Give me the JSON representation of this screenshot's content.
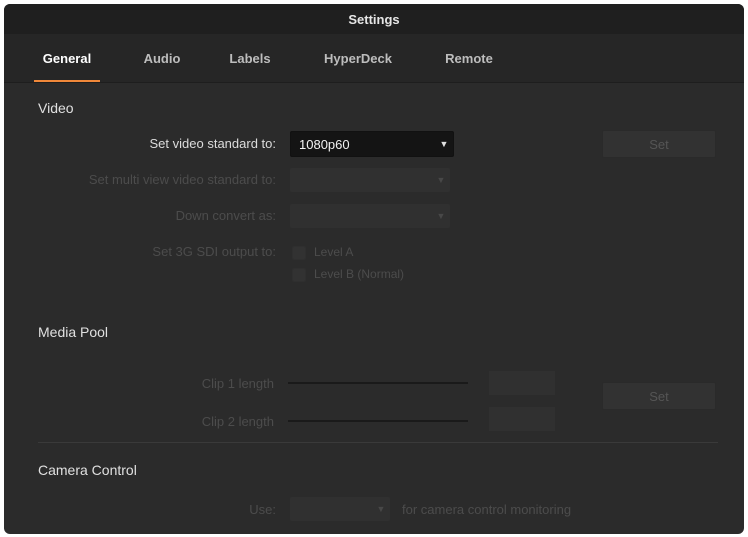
{
  "window": {
    "title": "Settings"
  },
  "tabs": [
    {
      "label": "General",
      "active": true
    },
    {
      "label": "Audio",
      "active": false
    },
    {
      "label": "Labels",
      "active": false
    },
    {
      "label": "HyperDeck",
      "active": false
    },
    {
      "label": "Remote",
      "active": false
    }
  ],
  "video": {
    "title": "Video",
    "standard_label": "Set video standard to:",
    "standard_value": "1080p60",
    "set_label": "Set",
    "multiview_label": "Set multi view video standard to:",
    "multiview_value": "",
    "downconvert_label": "Down convert as:",
    "downconvert_value": "",
    "sdi_label": "Set 3G SDI output to:",
    "level_a": "Level A",
    "level_b": "Level B (Normal)"
  },
  "media_pool": {
    "title": "Media Pool",
    "clip1_label": "Clip 1 length",
    "clip2_label": "Clip 2 length",
    "set_label": "Set"
  },
  "camera_control": {
    "title": "Camera Control",
    "use_label": "Use:",
    "use_value": "",
    "suffix": "for camera control monitoring"
  },
  "colors": {
    "accent": "#f0883a",
    "window_bg": "#2b2b2b",
    "titlebar_bg": "#1f1f1f"
  },
  "icons": {
    "dropdown": "chevron-down-icon"
  }
}
